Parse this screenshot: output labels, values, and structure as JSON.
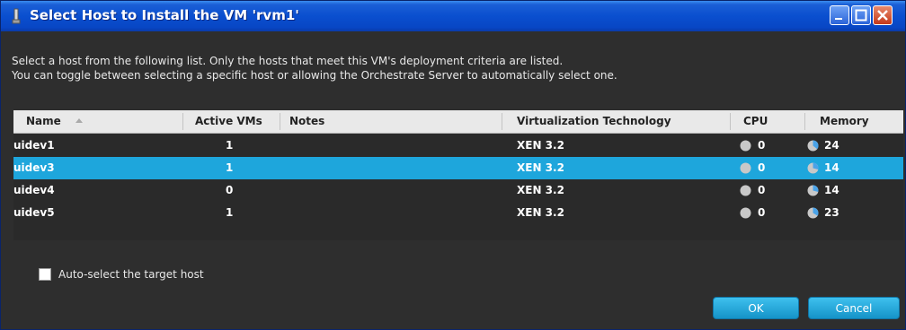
{
  "window": {
    "title": "Select Host to Install the VM 'rvm1'",
    "icon": "gear-icon"
  },
  "description": {
    "line1": "Select a host from the following list. Only the hosts that meet this VM's deployment criteria are listed.",
    "line2": "You can toggle between selecting a specific host or allowing the Orchestrate Server to automatically select one."
  },
  "table": {
    "columns": [
      "Name",
      "Active VMs",
      "Notes",
      "Virtualization Technology",
      "CPU",
      "Memory"
    ],
    "sort_column": "Name",
    "sort_direction": "ascending",
    "rows": [
      {
        "name": "uidev1",
        "active_vms": "1",
        "notes": "",
        "virt": "XEN 3.2",
        "cpu": "0",
        "memory": "24",
        "selected": false
      },
      {
        "name": "uidev3",
        "active_vms": "1",
        "notes": "",
        "virt": "XEN 3.2",
        "cpu": "0",
        "memory": "14",
        "selected": true
      },
      {
        "name": "uidev4",
        "active_vms": "0",
        "notes": "",
        "virt": "XEN 3.2",
        "cpu": "0",
        "memory": "14",
        "selected": false
      },
      {
        "name": "uidev5",
        "active_vms": "1",
        "notes": "",
        "virt": "XEN 3.2",
        "cpu": "0",
        "memory": "23",
        "selected": false
      }
    ]
  },
  "auto_select": {
    "label": "Auto-select the target host",
    "checked": false
  },
  "buttons": {
    "ok": "OK",
    "cancel": "Cancel"
  },
  "colors": {
    "title_bar": "#0a4fcf",
    "selected_row": "#1ea6dc",
    "pie_fill": "#4aa3e8",
    "pie_base": "#c8c8c8"
  }
}
